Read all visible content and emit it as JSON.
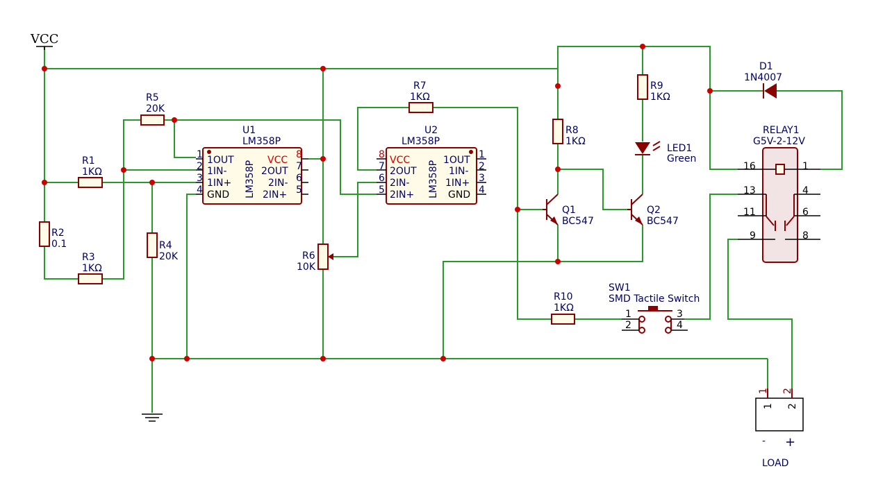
{
  "power": {
    "vcc_label": "VCC"
  },
  "resistors": {
    "r1": {
      "ref": "R1",
      "value": "1KΩ"
    },
    "r2": {
      "ref": "R2",
      "value": "0.1"
    },
    "r3": {
      "ref": "R3",
      "value": "1KΩ"
    },
    "r4": {
      "ref": "R4",
      "value": "20K"
    },
    "r5": {
      "ref": "R5",
      "value": "20K"
    },
    "r6": {
      "ref": "R6",
      "value": "10K"
    },
    "r7": {
      "ref": "R7",
      "value": "1KΩ"
    },
    "r8": {
      "ref": "R8",
      "value": "1KΩ"
    },
    "r9": {
      "ref": "R9",
      "value": "1KΩ"
    },
    "r10": {
      "ref": "R10",
      "value": "1KΩ"
    }
  },
  "u1": {
    "ref": "U1",
    "part": "LM358P",
    "body_text": "LM358P",
    "left_pins": [
      {
        "num": "1",
        "name": "1OUT"
      },
      {
        "num": "2",
        "name": "1IN-"
      },
      {
        "num": "3",
        "name": "1IN+"
      },
      {
        "num": "4",
        "name": "GND"
      }
    ],
    "right_pins": [
      {
        "num": "8",
        "name": "VCC"
      },
      {
        "num": "7",
        "name": "2OUT"
      },
      {
        "num": "6",
        "name": "2IN-"
      },
      {
        "num": "5",
        "name": "2IN+"
      }
    ]
  },
  "u2": {
    "ref": "U2",
    "part": "LM358P",
    "body_text": "LM358P",
    "left_pins": [
      {
        "num": "8",
        "name": "VCC"
      },
      {
        "num": "7",
        "name": "2OUT"
      },
      {
        "num": "6",
        "name": "2IN-"
      },
      {
        "num": "5",
        "name": "2IN+"
      }
    ],
    "right_pins": [
      {
        "num": "1",
        "name": "1OUT"
      },
      {
        "num": "2",
        "name": "1IN-"
      },
      {
        "num": "3",
        "name": "1IN+"
      },
      {
        "num": "4",
        "name": "GND"
      }
    ]
  },
  "q1": {
    "ref": "Q1",
    "part": "BC547"
  },
  "q2": {
    "ref": "Q2",
    "part": "BC547"
  },
  "d1": {
    "ref": "D1",
    "part": "1N4007"
  },
  "led1": {
    "ref": "LED1",
    "color": "Green"
  },
  "relay": {
    "ref": "RELAY1",
    "part": "G5V-2-12V",
    "pins_left": [
      "16",
      "13",
      "11",
      "9"
    ],
    "pins_right": [
      "1",
      "4",
      "6",
      "8"
    ]
  },
  "sw1": {
    "ref": "SW1",
    "part": "SMD Tactile Switch",
    "pins": [
      "1",
      "2",
      "3",
      "4"
    ]
  },
  "load": {
    "label": "LOAD",
    "pins": [
      "1",
      "2"
    ],
    "pin_marks": [
      "1",
      "2"
    ],
    "minus": "-",
    "plus": "+"
  },
  "colors": {
    "wire": "#279a27",
    "device": "#8a0000",
    "junction": "#cc0000",
    "text": "#000066"
  }
}
